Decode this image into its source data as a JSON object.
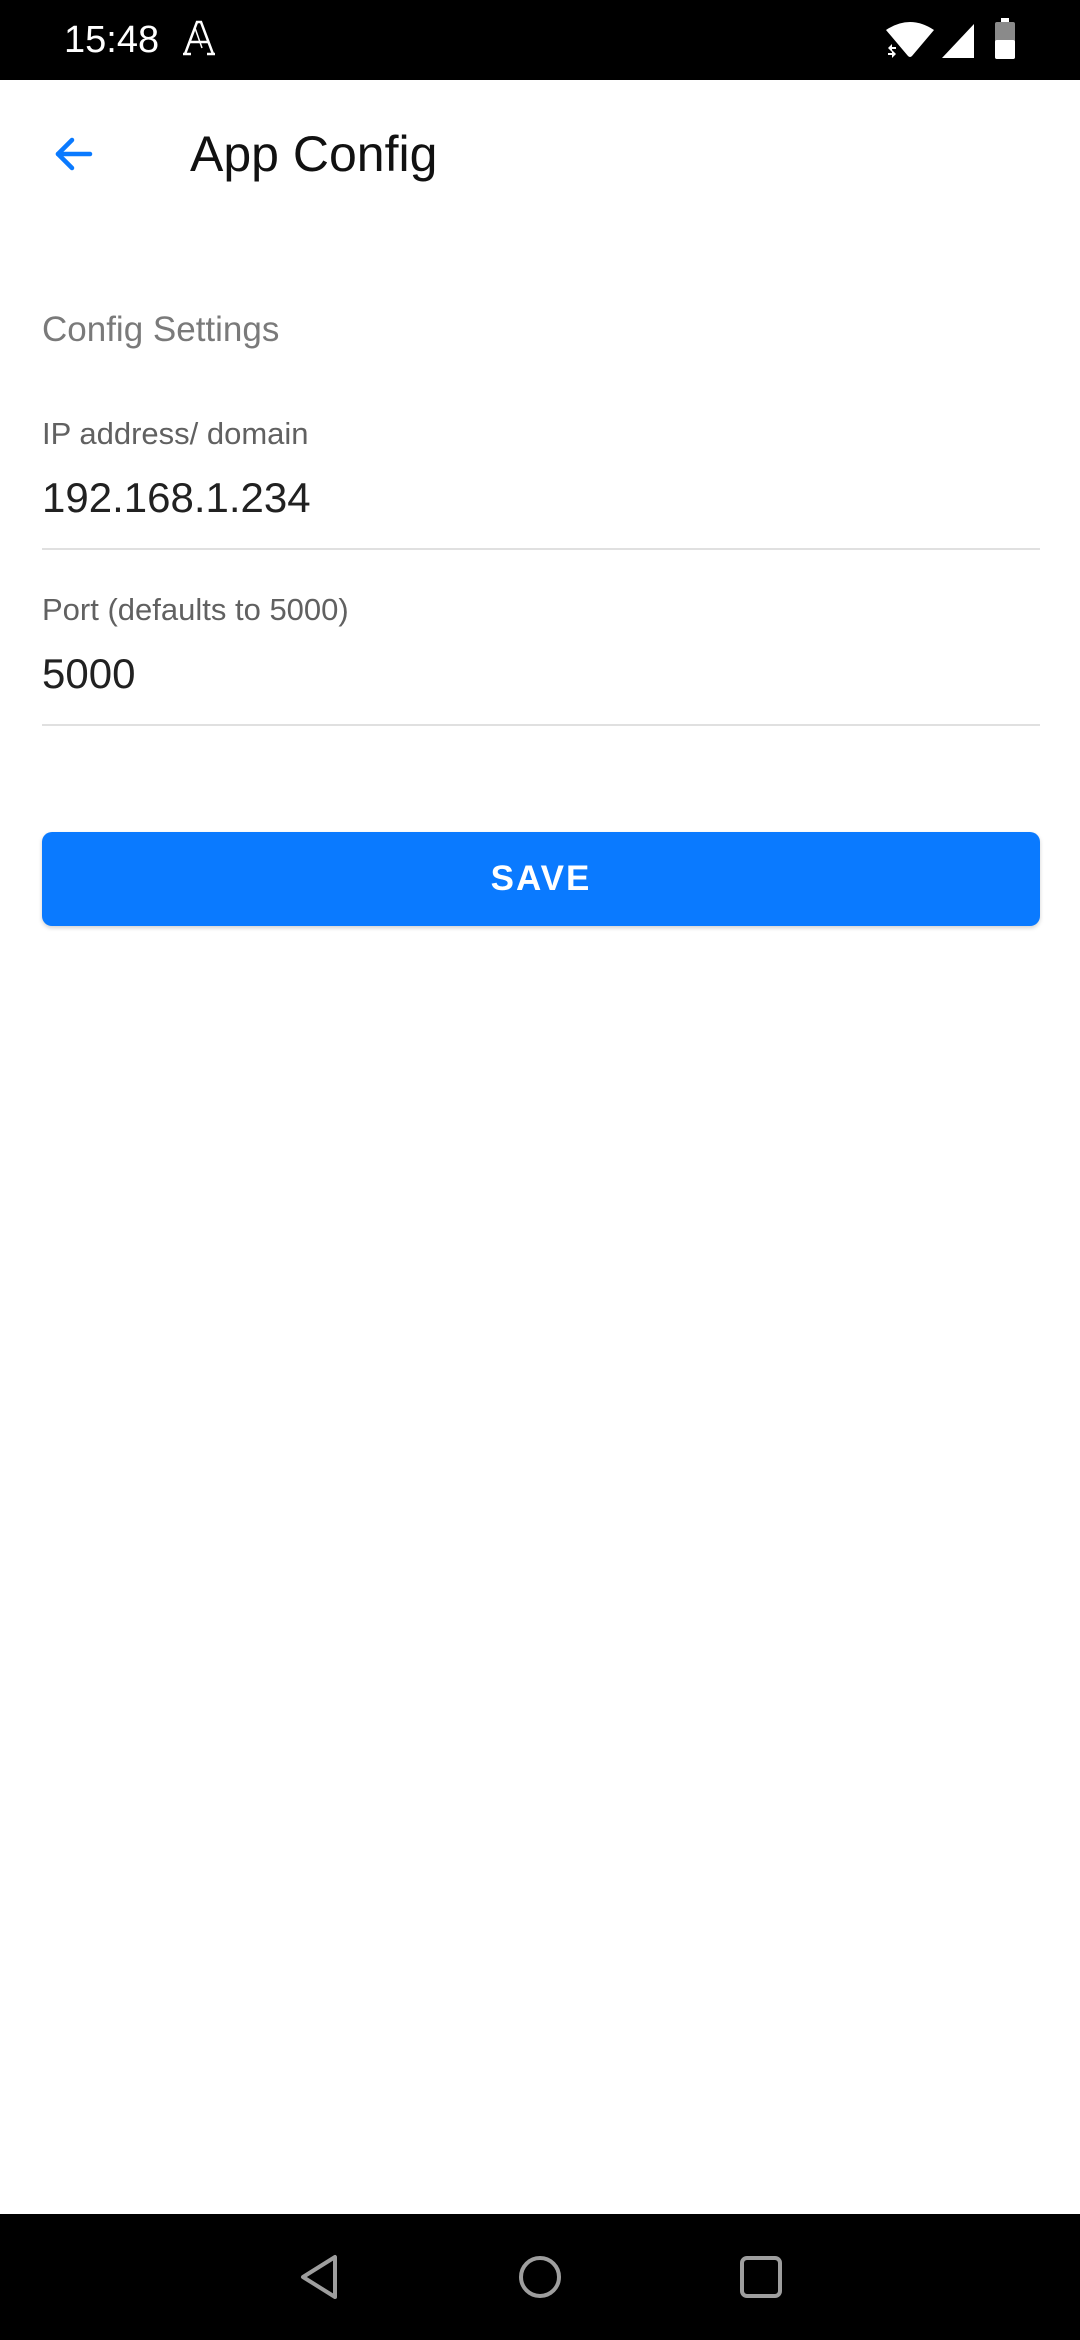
{
  "status_bar": {
    "time": "15:48",
    "icons": [
      "a-icon",
      "wifi-icon",
      "signal-icon",
      "battery-icon"
    ]
  },
  "app_bar": {
    "title": "App Config",
    "back_icon": "arrow-left-icon"
  },
  "content": {
    "section_title": "Config Settings",
    "ip_field": {
      "label": "IP address/ domain",
      "value": "192.168.1.234"
    },
    "port_field": {
      "label": "Port (defaults to 5000)",
      "value": "5000"
    },
    "save_label": "SAVE"
  },
  "nav_bar": {
    "icons": [
      "nav-back-icon",
      "nav-home-icon",
      "nav-recents-icon"
    ]
  },
  "colors": {
    "accent": "#0a7aff",
    "status_bar_bg": "#000000",
    "nav_bar_bg": "#000000",
    "section_header": "#7a7a7a",
    "divider": "#e0e0e0"
  }
}
